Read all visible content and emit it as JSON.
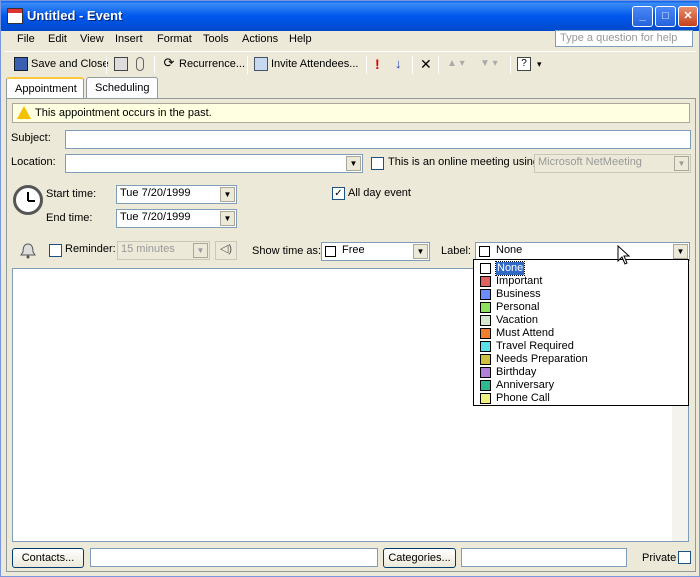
{
  "window": {
    "title": "Untitled - Event",
    "controls": [
      "minimize-icon",
      "maximize-icon",
      "close-icon"
    ]
  },
  "menu": {
    "items": [
      "File",
      "Edit",
      "View",
      "Insert",
      "Format",
      "Tools",
      "Actions",
      "Help"
    ],
    "ask_placeholder": "Type a question for help"
  },
  "toolbar": {
    "save_close": "Save and Close",
    "recurrence": "Recurrence...",
    "invite": "Invite Attendees..."
  },
  "tabs": [
    {
      "label": "Appointment",
      "active": true
    },
    {
      "label": "Scheduling",
      "active": false
    }
  ],
  "info_bar": "This appointment occurs in the past.",
  "form": {
    "subject_label": "Subject:",
    "subject_value": "",
    "location_label": "Location:",
    "location_value": "",
    "online_meeting_label": "This is an online meeting using:",
    "online_meeting_value": "Microsoft NetMeeting",
    "start_time_label": "Start time:",
    "start_date": "Tue 7/20/1999",
    "end_time_label": "End time:",
    "end_date": "Tue 7/20/1999",
    "all_day_label": "All day event",
    "all_day_checked": true,
    "reminder_label": "Reminder:",
    "reminder_value": "15 minutes",
    "show_time_label": "Show time as:",
    "show_time_value": "Free",
    "label_label": "Label:",
    "label_value": "None"
  },
  "label_options": [
    {
      "name": "None",
      "color": "#ffffff",
      "selected": true
    },
    {
      "name": "Important",
      "color": "#e06060"
    },
    {
      "name": "Business",
      "color": "#6b8cff"
    },
    {
      "name": "Personal",
      "color": "#90e060"
    },
    {
      "name": "Vacation",
      "color": "#d8e8d0"
    },
    {
      "name": "Must Attend",
      "color": "#f08030"
    },
    {
      "name": "Travel Required",
      "color": "#5ce0e8"
    },
    {
      "name": "Needs Preparation",
      "color": "#d0c040"
    },
    {
      "name": "Birthday",
      "color": "#b080d8"
    },
    {
      "name": "Anniversary",
      "color": "#30b890"
    },
    {
      "name": "Phone Call",
      "color": "#f0f080"
    }
  ],
  "footer": {
    "contacts": "Contacts...",
    "categories": "Categories...",
    "private": "Private"
  }
}
